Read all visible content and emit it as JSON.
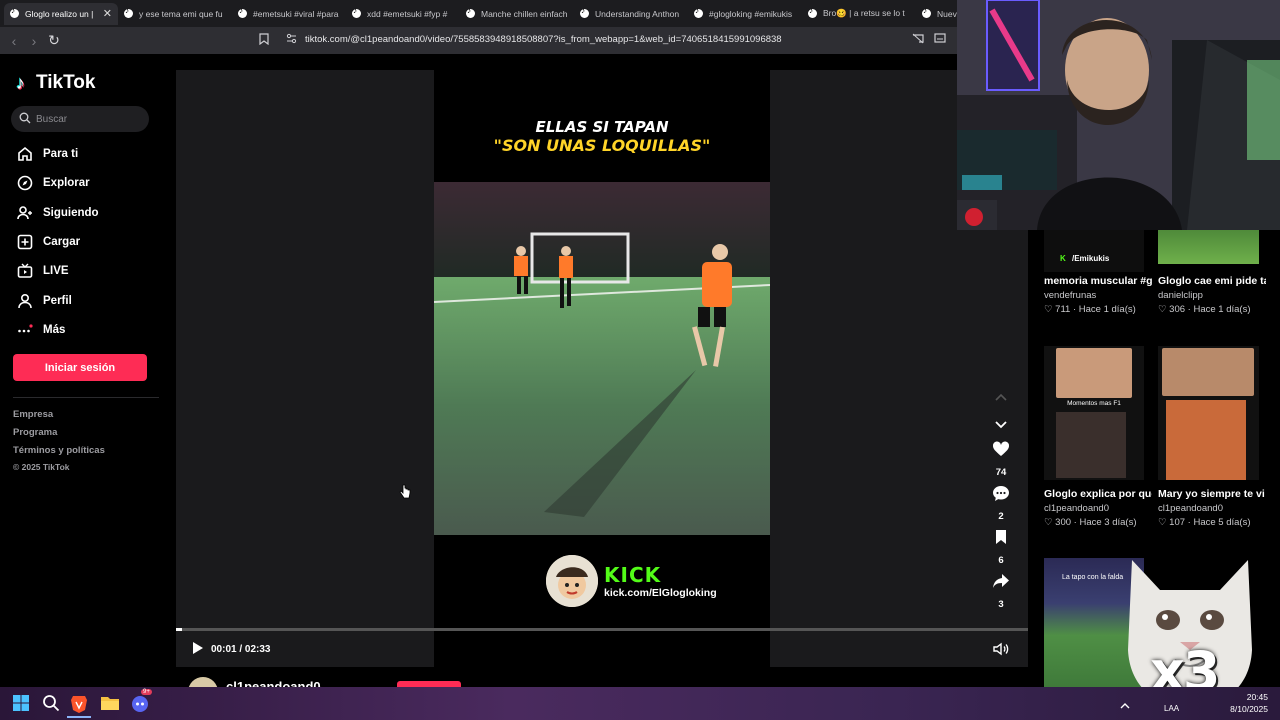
{
  "tabs": [
    {
      "label": "Gloglo realizo un |",
      "active": true
    },
    {
      "label": "y ese tema emi que fu"
    },
    {
      "label": "#emetsuki #viral #para"
    },
    {
      "label": "xdd #emetsuki #fyp #"
    },
    {
      "label": "Manche chillen einfach"
    },
    {
      "label": "Understanding Anthon"
    },
    {
      "label": "#glogloking #emikukis"
    },
    {
      "label": "Bro🥴 | a retsu se lo t"
    },
    {
      "label": "Nuev"
    }
  ],
  "address": {
    "url": "tiktok.com/@cl1peandoand0/video/7558583948918508807?is_from_webapp=1&web_id=7406518415991096838"
  },
  "sidebar": {
    "brand": "TikTok",
    "search_placeholder": "Buscar",
    "nav": [
      {
        "label": "Para ti",
        "icon": "home-icon"
      },
      {
        "label": "Explorar",
        "icon": "compass-icon"
      },
      {
        "label": "Siguiendo",
        "icon": "following-icon"
      },
      {
        "label": "Cargar",
        "icon": "upload-icon"
      },
      {
        "label": "LIVE",
        "icon": "live-icon"
      },
      {
        "label": "Perfil",
        "icon": "profile-icon"
      },
      {
        "label": "Más",
        "icon": "more-icon"
      }
    ],
    "login_label": "Iniciar sesión",
    "footer": [
      "Empresa",
      "Programa",
      "Términos y políticas",
      "© 2025 TikTok"
    ]
  },
  "video": {
    "caption_line1": "ELLAS SI TAPAN",
    "caption_line2": "\"SON UNAS LOQUILLAS\"",
    "kick_brand": "KICK",
    "kick_url": "kick.com/ElGlogloking",
    "time": "00:01 / 02:33",
    "progress": 0.007,
    "author": "cl1peandoand0",
    "likes": "74",
    "comments": "2",
    "saves": "6",
    "shares": "3"
  },
  "recommendations": [
    {
      "title": "memoria muscular #gloglo...",
      "author": "vendefrunas",
      "likes": "711",
      "age": "Hace 1 día(s)",
      "thumb_text": "/Emikukis"
    },
    {
      "title": "Gloglo cae emi pide tarjeta amarilla +...",
      "author": "danielclipp",
      "likes": "306",
      "age": "Hace 1 día(s)"
    },
    {
      "title": "Gloglo explica por que no colabora co...",
      "author": "cl1peandoand0",
      "likes": "300",
      "age": "Hace 3 día(s)",
      "thumb_text": "Momentos mas F1"
    },
    {
      "title": "Mary yo siempre te vi bien uff que rico...",
      "author": "cl1peandoand0",
      "likes": "107",
      "age": "Hace 5 día(s)"
    },
    {
      "thumb_text": "La tapo con la falda"
    }
  ],
  "taskbar": {
    "lang": "LAA",
    "time": "20:45",
    "date": "8/10/2025",
    "discord_badge": "9+"
  },
  "overlay": {
    "cat_label": "x3"
  },
  "colors": {
    "accent": "#fe2c55",
    "kick_green": "#53fc18",
    "caption_yellow": "#ffd428"
  }
}
